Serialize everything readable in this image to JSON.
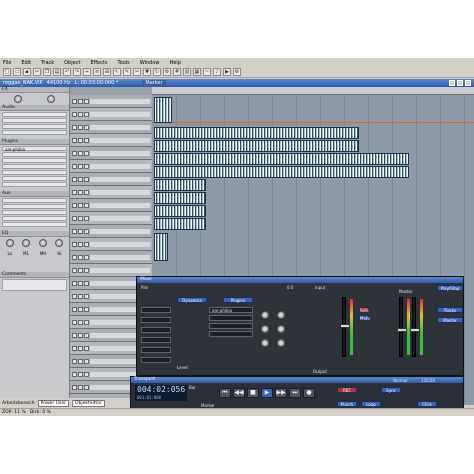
{
  "menubar": {
    "items": [
      "File",
      "Edit",
      "Track",
      "Object",
      "Effects",
      "Tools",
      "Window",
      "Help"
    ]
  },
  "toolbar": {
    "buttons": [
      "new",
      "open",
      "save",
      "cut",
      "copy",
      "paste",
      "undo",
      "redo",
      "zoom",
      "mix"
    ]
  },
  "project": {
    "title": "reggae_BAK.VIP",
    "samplerate": "44100 Hz",
    "length": "L: 00:03:00:000 *",
    "marker_label": "Marker"
  },
  "inspector": {
    "fx_label": "FX",
    "audio_label": "Audio",
    "plugins_label": "Plugins",
    "plugin_first": "am-phibia",
    "aux_label": "Aux",
    "eq_label": "EQ",
    "eq_bands": [
      "Lo",
      "ML",
      "MH",
      "Hi"
    ],
    "comments_label": "Comments"
  },
  "mixer": {
    "title": "Mixer",
    "dynamics_label": "Dynamics",
    "plugins_label": "Plugins",
    "plugin_item": "am-phibia",
    "pan_label": "Pan",
    "input_label": "Input",
    "output_label": "Output",
    "master_label": "Master",
    "playstop_label": "Play/Stop",
    "tracks_label": "Tracks",
    "solo_label": "Solo",
    "mute_label": "Mute",
    "vol_value": "0.0",
    "level_label": "Level"
  },
  "transport": {
    "title": "Transport",
    "time": "004:02:056",
    "time_sub": "001:02:000",
    "bar_label": "Bar",
    "marker_label": "Marker",
    "rec_label": "REC",
    "sync_label": "Sync",
    "punch_label": "Punch",
    "loop_label": "Loop",
    "click_label": "Click",
    "mode": "Normal",
    "bpm": "120.00"
  },
  "bottombar": {
    "workspace_label": "Arbeitsbereich",
    "user_mode": "Power User",
    "objects_label": "Objektedtor"
  },
  "statusbar": {
    "zoom": "ZOP: 11 %",
    "disk": "Disk: 0 %"
  }
}
